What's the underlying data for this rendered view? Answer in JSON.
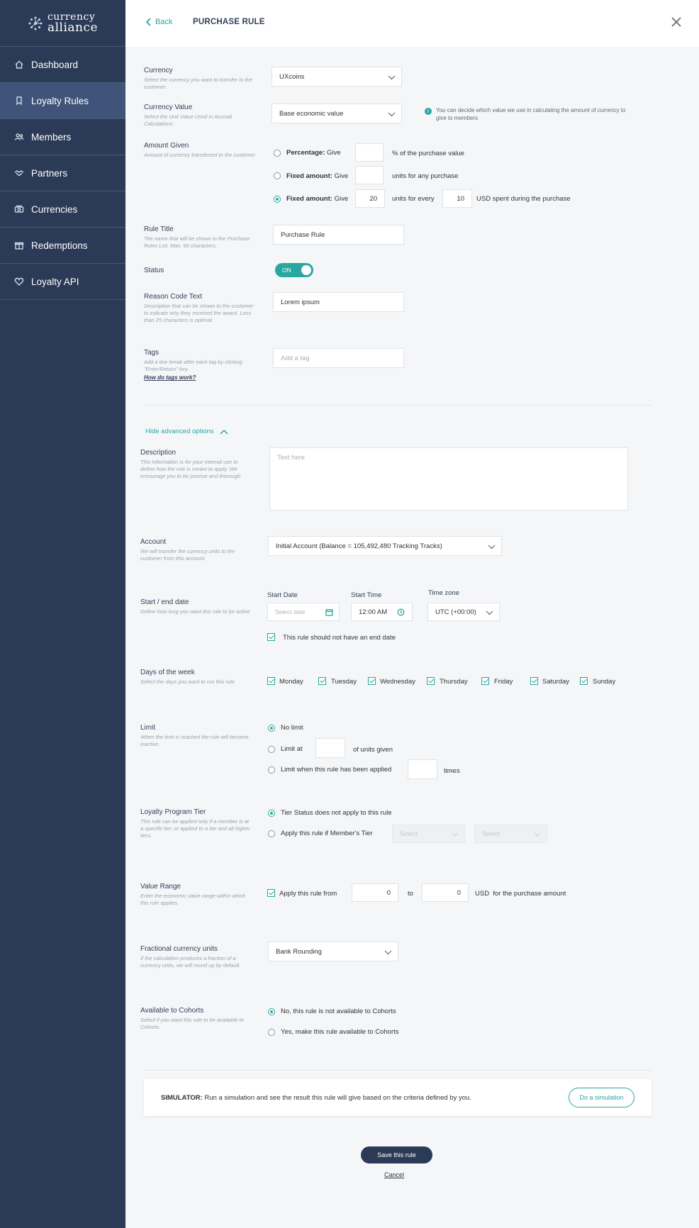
{
  "brand": {
    "line1": "currency",
    "line2": "alliance"
  },
  "sidebar": {
    "items": [
      {
        "label": "Dashboard",
        "icon": "home-icon"
      },
      {
        "label": "Loyalty Rules",
        "icon": "bookmark-icon",
        "active": true
      },
      {
        "label": "Members",
        "icon": "users-icon"
      },
      {
        "label": "Partners",
        "icon": "handshake-icon"
      },
      {
        "label": "Currencies",
        "icon": "coins-icon"
      },
      {
        "label": "Redemptions",
        "icon": "gift-icon"
      },
      {
        "label": "Loyalty API",
        "icon": "heart-icon"
      }
    ]
  },
  "header": {
    "back_label": "Back",
    "title": "PURCHASE RULE"
  },
  "form": {
    "currency": {
      "label": "Currency",
      "help": "Select the currency you want to transfer to the customer.",
      "value": "UXcoins"
    },
    "currency_value": {
      "label": "Currency Value",
      "help": "Select the Unit Value Used in Accrual Calculations",
      "value": "Base economic value",
      "info": "You can decide which value we use in calculating the amount of currency to give to members"
    },
    "amount_given": {
      "label": "Amount Given",
      "help": "Amount of currency transferred to the customer",
      "percentage_label": "Percentage:",
      "give": "Give",
      "percentage_suffix": "% of the purchase value",
      "fixed_label": "Fixed amount:",
      "fixed_any_suffix": "units for any purchase",
      "units_value": "20",
      "units_for_every": "units for every",
      "usd_value": "10",
      "usd_suffix": "USD spent during the purchase"
    },
    "rule_title": {
      "label": "Rule Title",
      "help": "The name that will be shown in the Purchase Rules List. Max. 50 characters.",
      "value": "Purchase Rule"
    },
    "status": {
      "label": "Status",
      "value": "ON"
    },
    "reason_code": {
      "label": "Reason Code Text",
      "help": "Description that can be shown to the customer to indicate why they received the award. Less than 25 characters is optimal.",
      "value": "Lorem ipsum"
    },
    "tags": {
      "label": "Tags",
      "help": "Add a line break after each tag by clicking \"Enter/Return\" key.",
      "link": "How do tags work?",
      "placeholder": "Add a tag"
    },
    "advanced_toggle": "Hide advanced options",
    "description": {
      "label": "Description",
      "help": "This information is for your internal use to define how the rule is meant to apply. We encourage you to be precise and thorough.",
      "placeholder": "Text here"
    },
    "account": {
      "label": "Account",
      "help": "We will transfer the currency units to the customer from this account.",
      "value": "Initial Account (Balance = 105,492,480 Tracking Tracks)"
    },
    "dates": {
      "label": "Start / end date",
      "help": "Define how long you want this rule to be active",
      "start_date_label": "Start Date",
      "start_date_placeholder": "Select date",
      "start_time_label": "Start Time",
      "start_time_value": "12:00 AM",
      "timezone_label": "Time zone",
      "timezone_value": "UTC (+00:00)",
      "no_end": "This rule should not have an end date"
    },
    "days": {
      "label": "Days of the week",
      "help": "Select the days you want to run this rule",
      "items": [
        "Monday",
        "Tuesday",
        "Wednesday",
        "Thursday",
        "Friday",
        "Saturday",
        "Sunday"
      ]
    },
    "limit": {
      "label": "Limit",
      "help": "When the limit is reached the rule will become inactive.",
      "no_limit": "No limit",
      "limit_at": "Limit at",
      "of_units": "of units given",
      "limit_applied": "Limit when this rule has been applied",
      "times": "times"
    },
    "tier": {
      "label": "Loyalty Program Tier",
      "help": "This rule can be applied only if a member is at a specific tier, or applied to a tier and all higher tiers.",
      "opt1": "Tier Status does not apply to this rule",
      "opt2": "Apply this rule if Member's Tier",
      "sel1": "Select",
      "sel2": "Select"
    },
    "value_range": {
      "label": "Value Range",
      "help": "Enter the economic value range within which this rule applies.",
      "apply": "Apply this rule from",
      "from_value": "0",
      "to": "to",
      "to_value": "0",
      "usd": "USD",
      "suffix": "for the purchase amount"
    },
    "fractional": {
      "label": "Fractional currency units",
      "help": "If the calculation produces a fraction of a currency units, we will round up by default.",
      "value": "Bank Rounding"
    },
    "cohorts": {
      "label": "Available to Cohorts",
      "help": "Select if you want this rule to be available to Cohorts.",
      "opt1": "No, this rule is not available to Cohorts",
      "opt2": "Yes, make this rule available to Cohorts"
    }
  },
  "simulator": {
    "title": "SIMULATOR:",
    "text": "Run a simulation and see the result this rule will give based on the criteria defined by you.",
    "button": "Do a simulation"
  },
  "actions": {
    "save": "Save this rule",
    "cancel": "Cancel"
  },
  "colors": {
    "sidebar": "#2b3a56",
    "accent": "#2aa7a0",
    "background": "#f4f6f8"
  }
}
